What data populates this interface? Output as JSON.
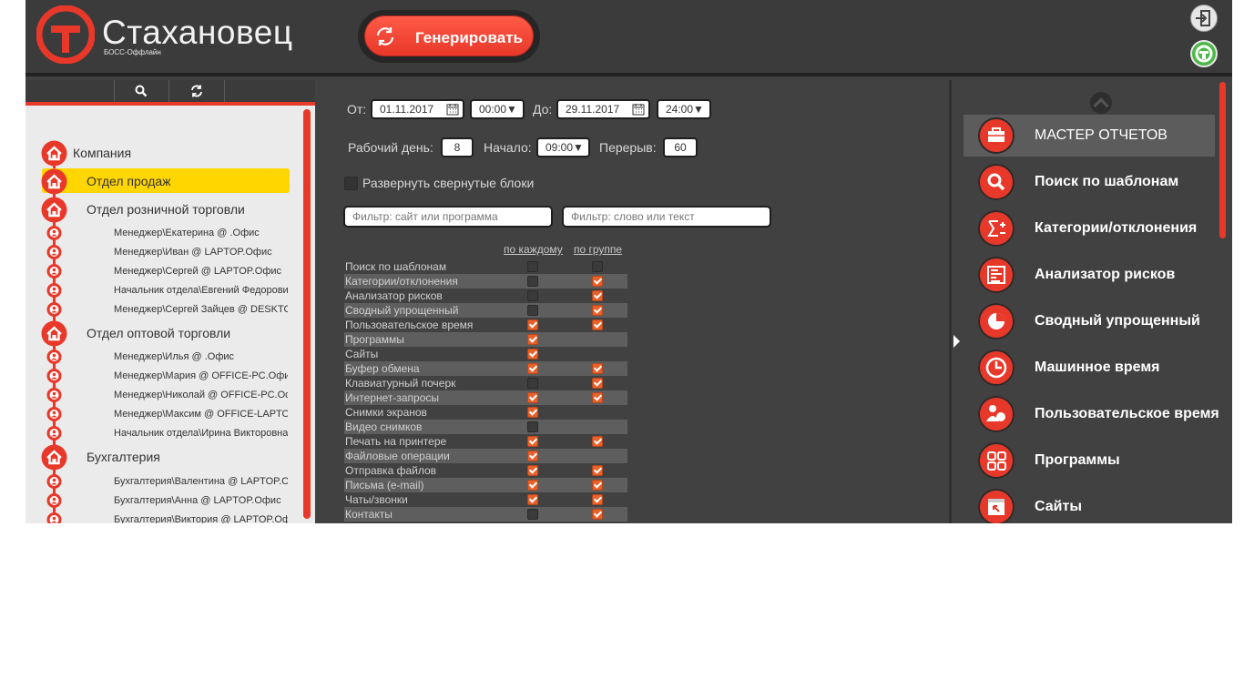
{
  "brand": {
    "title": "Стахановец",
    "subtitle": "БОСС-Оффлайн"
  },
  "header": {
    "generate_label": "Генерировать"
  },
  "colors": {
    "accent": "#e8382a",
    "selected": "#ffd600",
    "panel": "#414141",
    "checkbox_on": "#e8612a"
  },
  "tree": {
    "items": [
      {
        "type": "root",
        "label": "Компания"
      },
      {
        "type": "dept",
        "label": "Отдел продаж",
        "selected": true
      },
      {
        "type": "dept",
        "label": "Отдел розничной торговли"
      },
      {
        "type": "user",
        "label": "Менеджер\\Екатерина @ .Офис"
      },
      {
        "type": "user",
        "label": "Менеджер\\Иван @ LAPTOP.Офис"
      },
      {
        "type": "user",
        "label": "Менеджер\\Сергей @ LAPTOP.Офис"
      },
      {
        "type": "user",
        "label": "Начальник отдела\\Евгений Федорович"
      },
      {
        "type": "user",
        "label": "Менеджер\\Сергей Зайцев @ DESKTOP"
      },
      {
        "type": "dept",
        "label": "Отдел оптовой торговли"
      },
      {
        "type": "user",
        "label": "Менеджер\\Илья @ .Офис"
      },
      {
        "type": "user",
        "label": "Менеджер\\Мария @ OFFICE-PC.Офис"
      },
      {
        "type": "user",
        "label": "Менеджер\\Николай @ OFFICE-PC.Офис"
      },
      {
        "type": "user",
        "label": "Менеджер\\Максим @ OFFICE-LAPTOP"
      },
      {
        "type": "user",
        "label": "Начальник отдела\\Ирина Викторовна"
      },
      {
        "type": "dept",
        "label": "Бухгалтерия"
      },
      {
        "type": "user",
        "label": "Бухгалтерия\\Валентина @ LAPTOP.Офис"
      },
      {
        "type": "user",
        "label": "Бухгалтерия\\Анна @ LAPTOP.Офис"
      },
      {
        "type": "user",
        "label": "Бухгалтерия\\Виктория @ LAPTOP.Офис"
      }
    ]
  },
  "filters": {
    "from_label": "От:",
    "from_date": "01.11.2017",
    "from_time": "00:00▼",
    "to_label": "До:",
    "to_date": "29.11.2017",
    "to_time": "24:00▼",
    "workday_label": "Рабочий день:",
    "workday_value": "8",
    "start_label": "Начало:",
    "start_value": "09:00▼",
    "break_label": "Перерыв:",
    "break_value": "60",
    "expand_label": "Развернуть свернутые блоки",
    "filter_site_placeholder": "Фильтр: сайт или программа",
    "filter_word_placeholder": "Фильтр: слово или текст",
    "col_each": "по каждому",
    "col_group": "по группе"
  },
  "options": [
    {
      "label": "Поиск по шаблонам",
      "each": false,
      "group": false
    },
    {
      "label": "Категории/отклонения",
      "each": false,
      "group": true
    },
    {
      "label": "Анализатор рисков",
      "each": false,
      "group": true
    },
    {
      "label": "Сводный упрощенный",
      "each": false,
      "group": true
    },
    {
      "label": "Пользовательское время",
      "each": true,
      "group": true
    },
    {
      "label": "Программы",
      "each": true,
      "group": null
    },
    {
      "label": "Сайты",
      "each": true,
      "group": null
    },
    {
      "label": "Буфер обмена",
      "each": true,
      "group": true
    },
    {
      "label": "Клавиатурный почерк",
      "each": false,
      "group": true
    },
    {
      "label": "Интернет-запросы",
      "each": true,
      "group": true
    },
    {
      "label": "Снимки экранов",
      "each": true,
      "group": null
    },
    {
      "label": "Видео снимков",
      "each": false,
      "group": null
    },
    {
      "label": "Печать на принтере",
      "each": true,
      "group": true
    },
    {
      "label": "Файловые операции",
      "each": true,
      "group": null
    },
    {
      "label": "Отправка файлов",
      "each": true,
      "group": true
    },
    {
      "label": "Письма (e-mail)",
      "each": true,
      "group": true
    },
    {
      "label": "Чаты/звонки",
      "each": true,
      "group": true
    },
    {
      "label": "Контакты",
      "each": false,
      "group": true
    }
  ],
  "menu": {
    "items": [
      {
        "label": "МАСТЕР ОТЧЕТОВ",
        "icon": "briefcase-icon",
        "active": true
      },
      {
        "label": "Поиск по шаблонам",
        "icon": "search-icon"
      },
      {
        "label": "Категории/отклонения",
        "icon": "sigma-icon"
      },
      {
        "label": "Анализатор рисков",
        "icon": "bar-list-icon"
      },
      {
        "label": "Сводный упрощенный",
        "icon": "pie-chart-icon"
      },
      {
        "label": "Машинное время",
        "icon": "clock-icon"
      },
      {
        "label": "Пользовательское время",
        "icon": "user-time-icon"
      },
      {
        "label": "Программы",
        "icon": "apps-grid-icon"
      },
      {
        "label": "Сайты",
        "icon": "browser-window-icon"
      }
    ]
  }
}
